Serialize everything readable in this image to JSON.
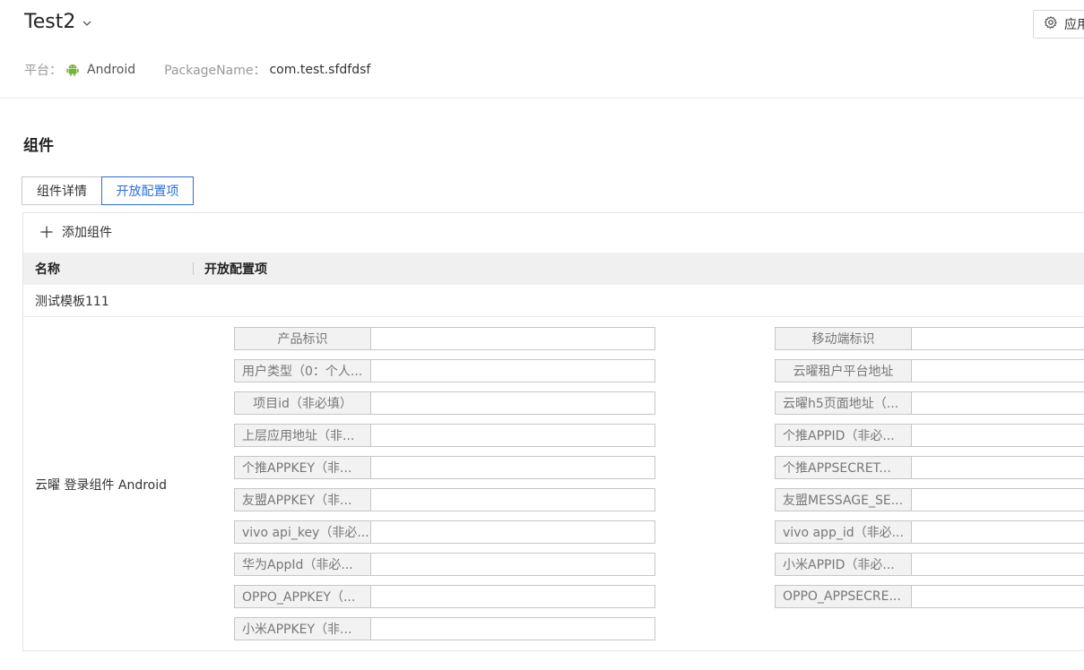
{
  "header": {
    "app_title": "Test2",
    "settings_label": "应用",
    "platform_label": "平台：",
    "platform_value": "Android",
    "package_label": "PackageName：",
    "package_value": "com.test.sfdfdsf"
  },
  "section": {
    "title": "组件"
  },
  "tabs": [
    {
      "label": "组件详情",
      "active": false
    },
    {
      "label": "开放配置项",
      "active": true
    }
  ],
  "toolbar": {
    "add_label": "添加组件"
  },
  "table": {
    "columns": [
      "名称",
      "开放配置项"
    ],
    "rows": [
      {
        "name": "测试模板111"
      },
      {
        "name": "云曜 登录组件 Android"
      }
    ]
  },
  "config_fields": {
    "left": [
      {
        "label": "产品标识",
        "value": ""
      },
      {
        "label": "用户类型（0：个人...",
        "value": ""
      },
      {
        "label": "项目id（非必填）",
        "value": ""
      },
      {
        "label": "上层应用地址（非...",
        "value": ""
      },
      {
        "label": "个推APPKEY（非...",
        "value": ""
      },
      {
        "label": "友盟APPKEY（非...",
        "value": ""
      },
      {
        "label": "vivo api_key（非必...",
        "value": ""
      },
      {
        "label": "华为AppId（非必...",
        "value": ""
      },
      {
        "label": "OPPO_APPKEY（...",
        "value": ""
      },
      {
        "label": "小米APPKEY（非...",
        "value": ""
      }
    ],
    "right": [
      {
        "label": "移动端标识",
        "value": ""
      },
      {
        "label": "云曜租户平台地址",
        "value": ""
      },
      {
        "label": "云曜h5页面地址（...",
        "value": ""
      },
      {
        "label": "个推APPID（非必...",
        "value": ""
      },
      {
        "label": "个推APPSECRET...",
        "value": ""
      },
      {
        "label": "友盟MESSAGE_SE...",
        "value": ""
      },
      {
        "label": "vivo app_id（非必...",
        "value": ""
      },
      {
        "label": "小米APPID（非必...",
        "value": ""
      },
      {
        "label": "OPPO_APPSECRE...",
        "value": ""
      }
    ]
  },
  "colors": {
    "accent": "#2c6fdb",
    "android_green": "#78b33a"
  }
}
